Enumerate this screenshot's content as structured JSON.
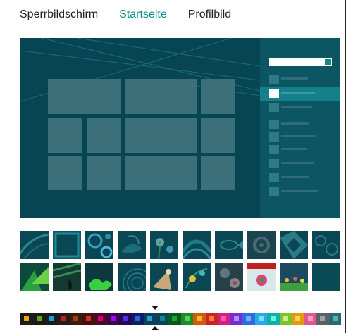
{
  "tabs": [
    {
      "label": "Sperrbildschirm",
      "active": false
    },
    {
      "label": "Startseite",
      "active": true
    },
    {
      "label": "Profilbild",
      "active": false
    }
  ],
  "colors": {
    "accent": "#0d8f8f",
    "background": "#084553",
    "tile": "#3b6f79",
    "charm": "#0c5563",
    "charm_selected": "#14808a"
  },
  "patterns": [
    "pattern-arcs",
    "pattern-frame",
    "pattern-swirls",
    "pattern-leaves",
    "pattern-flowers",
    "pattern-waves",
    "pattern-fish",
    "pattern-gears-dark",
    "pattern-geometric",
    "pattern-gears",
    "pattern-green-triangles",
    "pattern-stripes-drop",
    "pattern-splash",
    "pattern-concentric",
    "pattern-bird",
    "pattern-vines",
    "pattern-paisley",
    "pattern-folk-art",
    "pattern-garden",
    "pattern-plain"
  ],
  "palette": [
    {
      "bg": "#1b1b1b",
      "dot": "#f0a30a"
    },
    {
      "bg": "#1b1b1b",
      "dot": "#60a917"
    },
    {
      "bg": "#1b1b1b",
      "dot": "#1ba1e2"
    },
    {
      "bg": "#2a1a1a",
      "dot": "#b0232a"
    },
    {
      "bg": "#3a1c0e",
      "dot": "#a0410d"
    },
    {
      "bg": "#4a0e0e",
      "dot": "#c0392b"
    },
    {
      "bg": "#4a0a2a",
      "dot": "#d80073"
    },
    {
      "bg": "#3a0a45",
      "dot": "#a200ff"
    },
    {
      "bg": "#220a55",
      "dot": "#5a2be2"
    },
    {
      "bg": "#0a1f66",
      "dot": "#2d64d8"
    },
    {
      "bg": "#0a3f5e",
      "dot": "#2aa0d0"
    },
    {
      "bg": "#084553",
      "dot": "#0a8a8a"
    },
    {
      "bg": "#0a5a20",
      "dot": "#1ba532"
    },
    {
      "bg": "#1f8a2e",
      "dot": "#58d34a"
    },
    {
      "bg": "#d25a0e",
      "dot": "#f0c020"
    },
    {
      "bg": "#c4252a",
      "dot": "#ff7a33"
    },
    {
      "bg": "#d1207e",
      "dot": "#ff5aa8"
    },
    {
      "bg": "#7a2bd8",
      "dot": "#b48cff"
    },
    {
      "bg": "#2d6be0",
      "dot": "#6fb0ff"
    },
    {
      "bg": "#29a9e8",
      "dot": "#7ee0ff"
    },
    {
      "bg": "#0fb0a8",
      "dot": "#6bf2e0"
    },
    {
      "bg": "#7cc229",
      "dot": "#c8f08a"
    },
    {
      "bg": "#e39a12",
      "dot": "#ffd24a"
    },
    {
      "bg": "#e0568f",
      "dot": "#ff9cc8"
    },
    {
      "bg": "#5a6266",
      "dot": "#9aa5aa"
    },
    {
      "bg": "#2a6a70",
      "dot": "#58b0b0"
    }
  ],
  "selected_palette_index": 11
}
